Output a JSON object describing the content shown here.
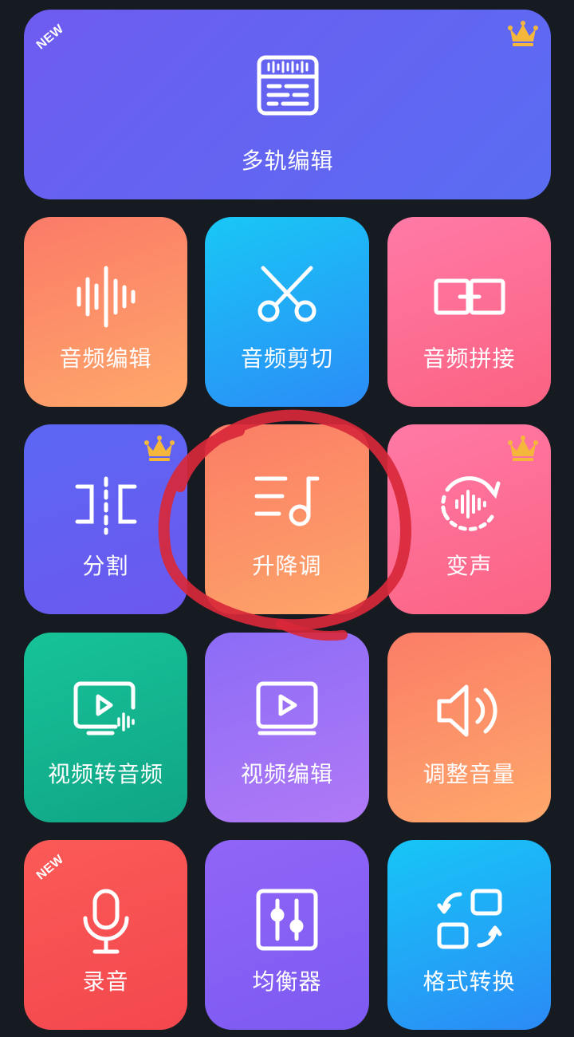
{
  "badges": {
    "new": "NEW"
  },
  "tiles": {
    "multitrack": {
      "label": "多轨编辑",
      "new": true,
      "premium": true
    },
    "audio_edit": {
      "label": "音频编辑"
    },
    "audio_cut": {
      "label": "音频剪切"
    },
    "audio_join": {
      "label": "音频拼接"
    },
    "split": {
      "label": "分割",
      "premium": true
    },
    "pitch": {
      "label": "升降调",
      "highlighted": true
    },
    "voice_change": {
      "label": "变声",
      "premium": true
    },
    "video_to_audio": {
      "label": "视频转音频"
    },
    "video_edit": {
      "label": "视频编辑"
    },
    "volume": {
      "label": "调整音量"
    },
    "record": {
      "label": "录音",
      "new": true
    },
    "equalizer": {
      "label": "均衡器"
    },
    "format": {
      "label": "格式转换"
    }
  },
  "icons": {
    "crown": "crown-icon",
    "multitrack": "multitrack-timeline-icon",
    "audio_edit": "waveform-icon",
    "audio_cut": "scissors-icon",
    "audio_join": "join-clips-icon",
    "split": "split-icon",
    "pitch": "music-note-lines-icon",
    "voice_change": "voice-cycle-icon",
    "video_to_audio": "video-audio-icon",
    "video_edit": "video-play-icon",
    "volume": "speaker-icon",
    "record": "microphone-icon",
    "equalizer": "equalizer-sliders-icon",
    "format": "format-swap-icon"
  },
  "colors": {
    "background": "#161b22",
    "crown": "#f5b73b",
    "annotation": "#d8283a"
  }
}
